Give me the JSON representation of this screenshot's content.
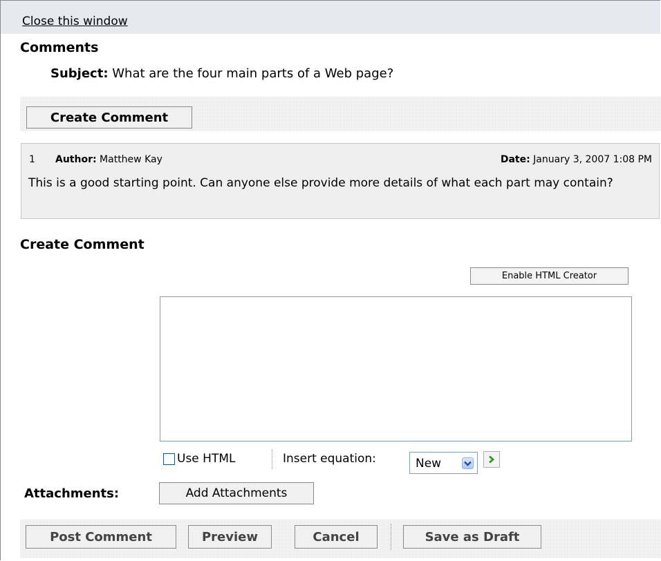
{
  "header": {
    "close_link": "Close this window",
    "title": "Comments",
    "subject_label": "Subject:",
    "subject_text": "What are the four main parts of a Web page?"
  },
  "toolbar": {
    "create_comment_button": "Create Comment"
  },
  "comment": {
    "number": "1",
    "author_label": "Author:",
    "author_name": "Matthew Kay",
    "date_label": "Date:",
    "date_value": "January 3, 2007 1:08 PM",
    "body": "This is a good starting point. Can anyone else provide more details of what each part may contain?"
  },
  "form": {
    "section_title": "Create Comment",
    "enable_html_creator_button": "Enable HTML Creator",
    "textarea_value": "",
    "use_html_label": "Use HTML",
    "use_html_checked": false,
    "insert_equation_label": "Insert equation:",
    "equation_selected": "New",
    "attachments_label": "Attachments:",
    "add_attachments_button": "Add Attachments"
  },
  "actions": {
    "post_comment": "Post Comment",
    "preview": "Preview",
    "cancel": "Cancel",
    "save_as_draft": "Save as Draft"
  },
  "icons": {
    "select_arrow": "chevron-down-icon",
    "go": "chevron-right-icon"
  },
  "colors": {
    "header_bg": "#e6eaf0",
    "comment_bg": "#efefef",
    "textarea_border": "#7f9db9",
    "go_arrow": "#2e9a16",
    "select_arrow": "#1f4ea8"
  }
}
